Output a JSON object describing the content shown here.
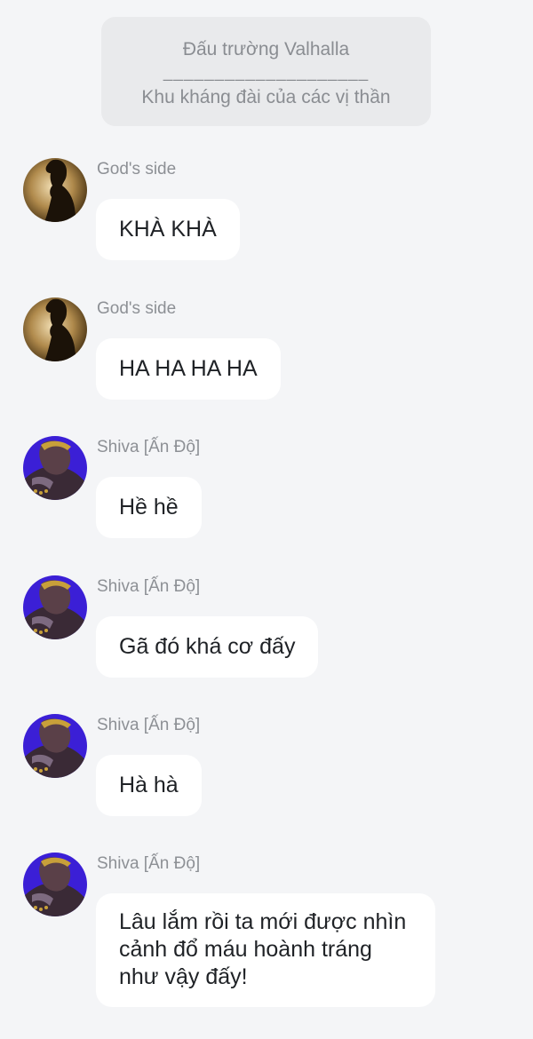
{
  "header": {
    "title": "Đấu trường Valhalla",
    "divider": "____________________",
    "subtitle": "Khu kháng đài của các vị thần"
  },
  "messages": [
    {
      "sender": "God's side",
      "avatar": "gods-side-avatar",
      "text": "KHÀ KHÀ"
    },
    {
      "sender": "God's side",
      "avatar": "gods-side-avatar",
      "text": "HA HA HA HA"
    },
    {
      "sender": "Shiva [Ấn Độ]",
      "avatar": "shiva-avatar",
      "text": "Hề hề"
    },
    {
      "sender": "Shiva [Ấn Độ]",
      "avatar": "shiva-avatar",
      "text": "Gã đó khá cơ đấy"
    },
    {
      "sender": "Shiva [Ấn Độ]",
      "avatar": "shiva-avatar",
      "text": "Hà hà"
    },
    {
      "sender": "Shiva [Ấn Độ]",
      "avatar": "shiva-avatar",
      "text": "Lâu lắm rồi ta mới được nhìn cảnh đổ máu hoành tráng như vậy đấy!"
    }
  ],
  "colors": {
    "background": "#f4f5f7",
    "header_card": "#e9eaec",
    "bubble": "#ffffff",
    "meta_text": "#8d9095",
    "message_text": "#1f2226",
    "shiva_accent": "#3b1fd6"
  }
}
